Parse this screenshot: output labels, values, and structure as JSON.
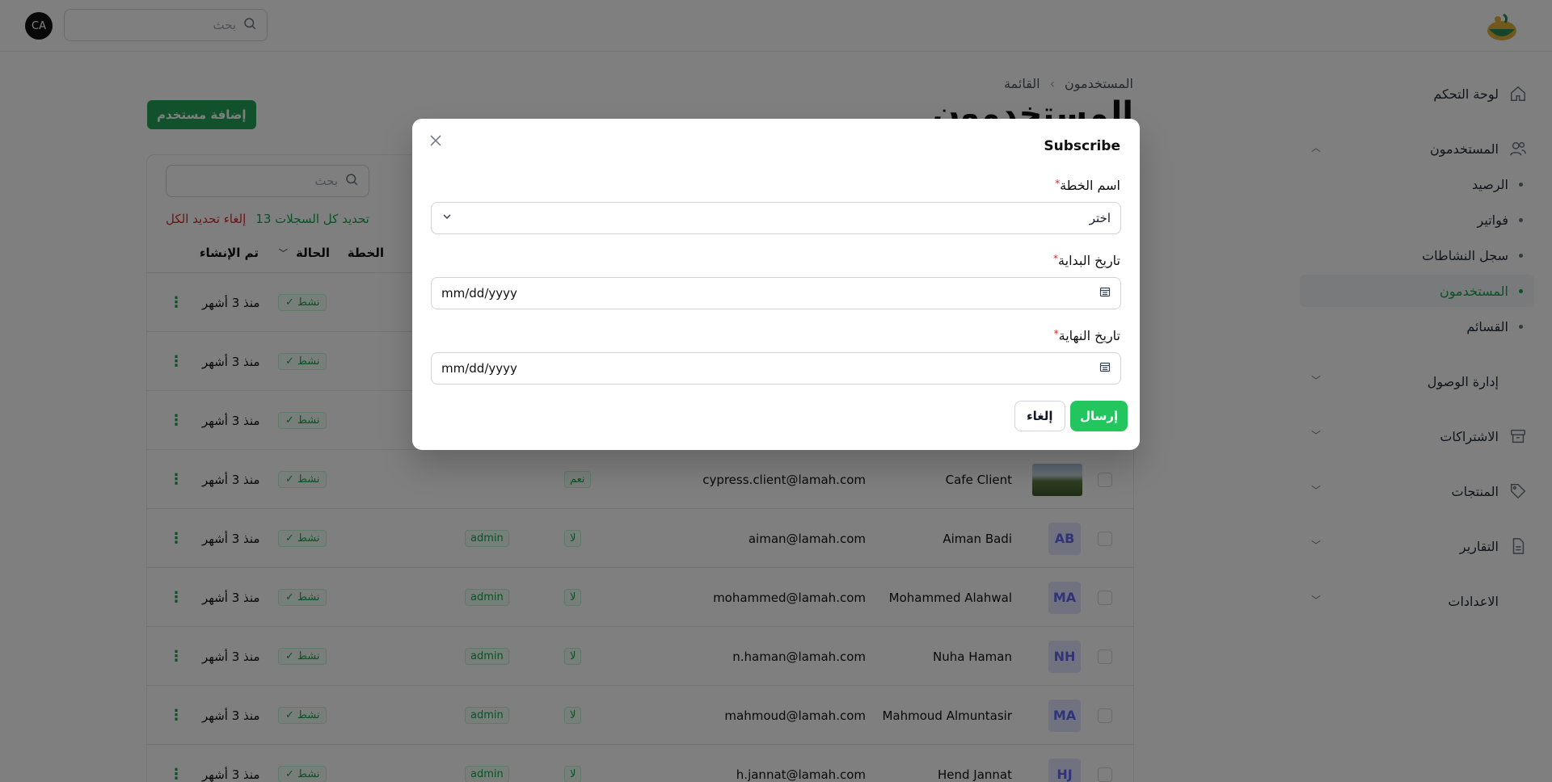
{
  "topbar": {
    "avatar_initials": "CA",
    "search_placeholder": "بحث"
  },
  "sidebar": {
    "dashboard": "لوحة التحكم",
    "users_group": "المستخدمون",
    "sub_items": [
      {
        "label": "الرصيد",
        "active": false
      },
      {
        "label": "فواتير",
        "active": false
      },
      {
        "label": "سجل النشاطات",
        "active": false
      },
      {
        "label": "المستخدمون",
        "active": true
      },
      {
        "label": "القسائم",
        "active": false
      }
    ],
    "access_management": "إدارة الوصول",
    "subscriptions": "الاشتراكات",
    "products": "المنتجات",
    "reports": "التقارير",
    "settings": "الاعدادات",
    "accent_color": "#16a34a"
  },
  "header": {
    "breadcrumb_root": "المستخدمون",
    "breadcrumb_current": "القائمة",
    "title": "المستخدمون",
    "add_button": "إضافة مستخدم"
  },
  "table": {
    "search_placeholder": "بحث",
    "select_all_label": "تحديد كل السجلات 13",
    "clear_selection_label": "إلغاء تحديد الكل",
    "columns": {
      "plan": "الخطة",
      "status": "الحالة",
      "created": "تم الإنشاء"
    },
    "rows": [
      {
        "name": "",
        "email": "",
        "verified": "",
        "role": "",
        "status": "نشط",
        "created": "منذ 3 أشهر",
        "avatar": ""
      },
      {
        "name": "",
        "email": "",
        "verified": "",
        "role": "",
        "status": "نشط",
        "created": "منذ 3 أشهر",
        "avatar": ""
      },
      {
        "name": "",
        "email": "",
        "verified": "",
        "role": "",
        "status": "نشط",
        "created": "منذ 3 أشهر",
        "avatar": ""
      },
      {
        "name": "Cafe Client",
        "email": "cypress.client@lamah.com",
        "verified": "نعم",
        "role": "",
        "status": "نشط",
        "created": "منذ 3 أشهر",
        "avatar": "photo"
      },
      {
        "name": "Aiman Badi",
        "email": "aiman@lamah.com",
        "verified": "لا",
        "role": "admin",
        "status": "نشط",
        "created": "منذ 3 أشهر",
        "avatar": "AB"
      },
      {
        "name": "Mohammed Alahwal",
        "email": "mohammed@lamah.com",
        "verified": "لا",
        "role": "admin",
        "status": "نشط",
        "created": "منذ 3 أشهر",
        "avatar": "MA"
      },
      {
        "name": "Nuha Haman",
        "email": "n.haman@lamah.com",
        "verified": "لا",
        "role": "admin",
        "status": "نشط",
        "created": "منذ 3 أشهر",
        "avatar": "NH"
      },
      {
        "name": "Mahmoud Almuntasir",
        "email": "mahmoud@lamah.com",
        "verified": "لا",
        "role": "admin",
        "status": "نشط",
        "created": "منذ 3 أشهر",
        "avatar": "MA"
      },
      {
        "name": "Hend Jannat",
        "email": "h.jannat@lamah.com",
        "verified": "لا",
        "role": "admin",
        "status": "نشط",
        "created": "منذ 3 أشهر",
        "avatar": "HJ"
      }
    ]
  },
  "modal": {
    "title": "Subscribe",
    "plan_label": "اسم الخطة",
    "plan_placeholder": "اختر",
    "start_label": "تاريخ البداية",
    "start_value": "mm/dd/yyyy",
    "end_label": "تاريخ النهاية",
    "end_value": "mm/dd/yyyy",
    "required_mark": "*",
    "cancel": "إلغاء",
    "submit": "إرسال"
  }
}
